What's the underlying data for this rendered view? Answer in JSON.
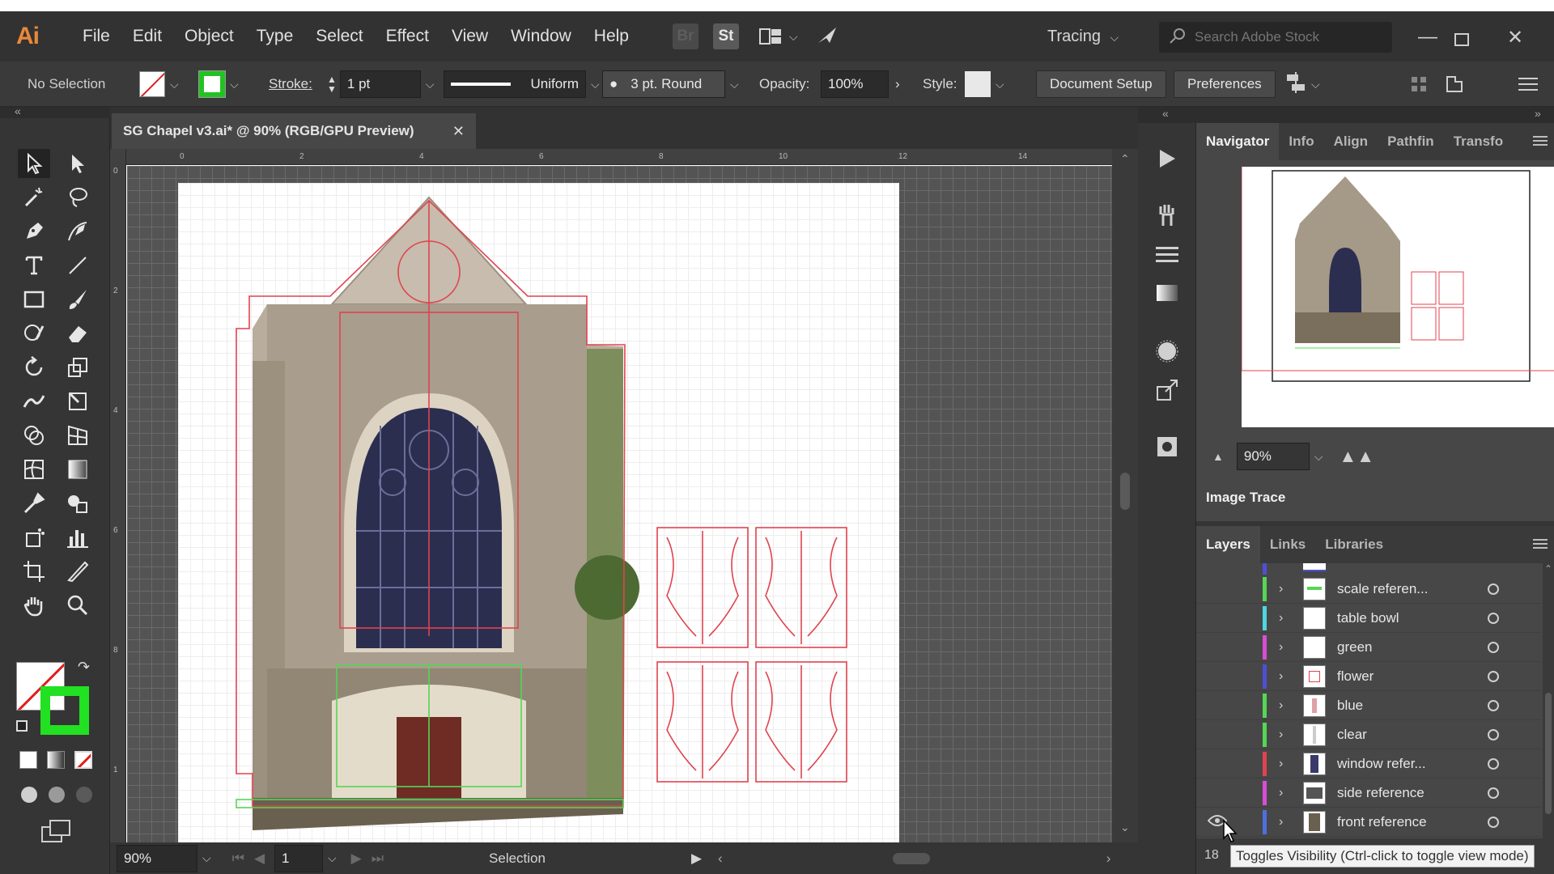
{
  "app": {
    "logo": "Ai",
    "menus": [
      "File",
      "Edit",
      "Object",
      "Type",
      "Select",
      "Effect",
      "View",
      "Window",
      "Help"
    ],
    "bridge_label": "Br",
    "stock_label": "St",
    "workspace": "Tracing",
    "search_placeholder": "Search Adobe Stock",
    "window_controls": [
      "minimize-icon",
      "maximize-icon",
      "close-icon"
    ]
  },
  "control_bar": {
    "selection_label": "No Selection",
    "stroke_label": "Stroke:",
    "stroke_value": "1 pt",
    "profile_label": "Uniform",
    "brush_label": "3 pt. Round",
    "opacity_label": "Opacity:",
    "opacity_value": "100%",
    "style_label": "Style:",
    "document_setup": "Document Setup",
    "preferences": "Preferences",
    "stroke_color": "#22c222",
    "fill_color": "none"
  },
  "document": {
    "tab_title": "SG Chapel v3.ai* @ 90% (RGB/GPU Preview)",
    "ruler_h_ticks": [
      "0",
      "2",
      "4",
      "6",
      "8",
      "10",
      "12",
      "14"
    ],
    "ruler_v_ticks": [
      "0",
      "2",
      "4",
      "6",
      "8",
      "1"
    ],
    "zoom": "90%",
    "artboard_number": "1",
    "status_tool": "Selection",
    "guide_color_red": "#e0434f",
    "guide_color_green": "#55d655"
  },
  "navigator": {
    "tabs": [
      "Navigator",
      "Info",
      "Align",
      "Pathfin",
      "Transfo"
    ],
    "active_tab": "Navigator",
    "zoom": "90%"
  },
  "image_trace": {
    "title": "Image Trace"
  },
  "layers_panel": {
    "tabs": [
      "Layers",
      "Links",
      "Libraries"
    ],
    "active_tab": "Layers",
    "layers": [
      {
        "name": "scale referen...",
        "color": "#55d655"
      },
      {
        "name": "table bowl",
        "color": "#4fd6e0"
      },
      {
        "name": "green",
        "color": "#d64fd6"
      },
      {
        "name": "flower",
        "color": "#4f4fd6"
      },
      {
        "name": "blue",
        "color": "#55d655"
      },
      {
        "name": "clear",
        "color": "#55d655"
      },
      {
        "name": "window refer...",
        "color": "#e0434f"
      },
      {
        "name": "side reference",
        "color": "#d64fd6"
      },
      {
        "name": "front reference",
        "color": "#4f6fe0"
      }
    ],
    "layer_count": "18",
    "tooltip": "Toggles Visibility (Ctrl-click to toggle view mode)"
  }
}
